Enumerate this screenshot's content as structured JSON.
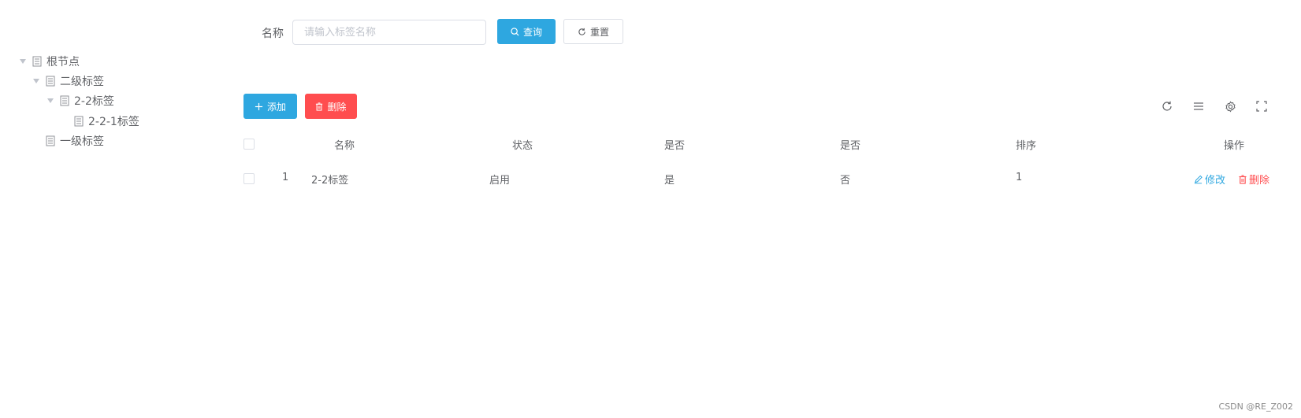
{
  "tree": {
    "nodes": [
      {
        "label": "根节点",
        "expanded": true,
        "level": 0
      },
      {
        "label": "二级标签",
        "expanded": true,
        "level": 1
      },
      {
        "label": "2-2标签",
        "expanded": true,
        "level": 2
      },
      {
        "label": "2-2-1标签",
        "expanded": false,
        "level": 3
      },
      {
        "label": "一级标签",
        "expanded": false,
        "level": 1
      }
    ]
  },
  "search": {
    "name_label": "名称",
    "name_placeholder": "请输入标签名称",
    "query_label": "查询",
    "reset_label": "重置"
  },
  "toolbar": {
    "add_label": "添加",
    "delete_label": "删除",
    "icons": [
      "refresh-icon",
      "list-icon",
      "settings-icon",
      "fullscreen-icon"
    ]
  },
  "table": {
    "headers": {
      "name": "名称",
      "status": "状态",
      "is_a": "是否",
      "is_b": "是否",
      "sort": "排序",
      "ops": "操作"
    },
    "rows": [
      {
        "index": "1",
        "name": "2-2标签",
        "status": "启用",
        "is_a": "是",
        "is_b": "否",
        "sort": "1",
        "edit_label": "修改",
        "delete_label": "删除"
      }
    ]
  },
  "colors": {
    "primary": "#2ea7e0",
    "danger": "#ff4d4f",
    "text": "#606266",
    "border": "#dcdfe6"
  },
  "watermark": "CSDN @RE_Z002"
}
